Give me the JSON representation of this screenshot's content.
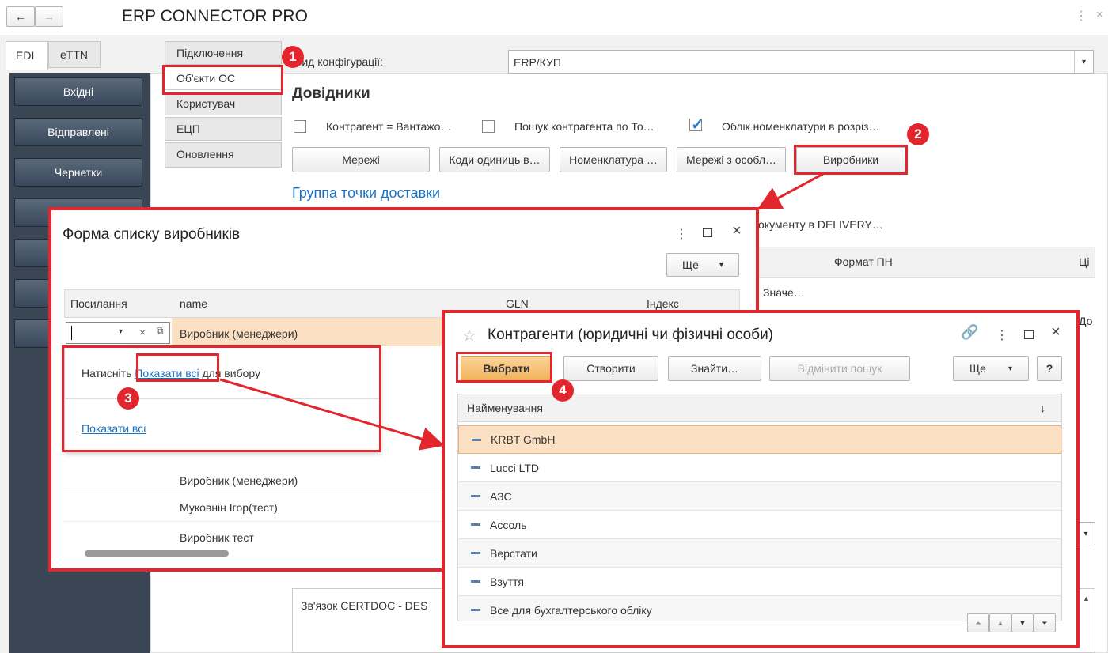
{
  "app": {
    "title": "ERP CONNECTOR PRO",
    "back_icon": "←",
    "forward_icon": "→",
    "menu_icon": "⋮",
    "close_icon": "×"
  },
  "tabs": [
    "EDI",
    "eTTN"
  ],
  "sidebar": {
    "items": [
      "Вхідні",
      "Відправлені",
      "Чернетки"
    ]
  },
  "subtabs": [
    "Підключення",
    "Об'єкти ОС",
    "Користувач",
    "ЕЦП",
    "Оновлення"
  ],
  "main": {
    "config_label": "Вид конфігурації:",
    "config_value": "ERP/КУП",
    "section_title": "Довідники",
    "checkboxes": [
      {
        "label": "Контрагент = Вантажо…",
        "checked": false
      },
      {
        "label": "Пошук контрагента по То…",
        "checked": false
      },
      {
        "label": "Облік номенклатури в розріз…",
        "checked": true
      }
    ],
    "buttons": [
      "Мережі",
      "Коди одиниць в…",
      "Номенклатура …",
      "Мережі з особл…",
      "Виробники"
    ],
    "link_title": "Группа точки доставки",
    "doc_text": "окументу в DELIVERY…",
    "col_format": "Формат ПН",
    "col_ci": "Ці",
    "value_short": "Значе…",
    "value_do": "До",
    "certdoc": "Зв'язок CERTDOC - DES"
  },
  "badges": [
    "1",
    "2",
    "3",
    "4"
  ],
  "manufacturers": {
    "title": "Форма списку виробників",
    "more": "Ще",
    "headers": [
      "Посилання",
      "name",
      "GLN",
      "Індекс"
    ],
    "selected_row": "Виробник (менеджери)",
    "hint_prefix": "Натисніть",
    "hint_link": "Показати всі",
    "hint_suffix": "для вибору",
    "show_all": "Показати всі",
    "rows": [
      "Виробник (менеджери)",
      "Муковнін Ігор(тест)",
      "Виробник тест"
    ]
  },
  "counterparties": {
    "title": "Контрагенти (юридичні чи фізичні особи)",
    "btn_select": "Вибрати",
    "btn_create": "Створити",
    "btn_find": "Знайти…",
    "btn_cancel": "Відмінити пошук",
    "more": "Ще",
    "help": "?",
    "header": "Найменування",
    "sort_icon": "↓",
    "rows": [
      "KRBT GmbH",
      "Lucci LTD",
      "АЗС",
      "Ассоль",
      "Верстати",
      "Взуття",
      "Все для бухгалтерського обліку"
    ]
  },
  "colors": {
    "accent_red": "#e3262d",
    "highlight": "#fbe0c4",
    "link": "#1a73c4"
  }
}
